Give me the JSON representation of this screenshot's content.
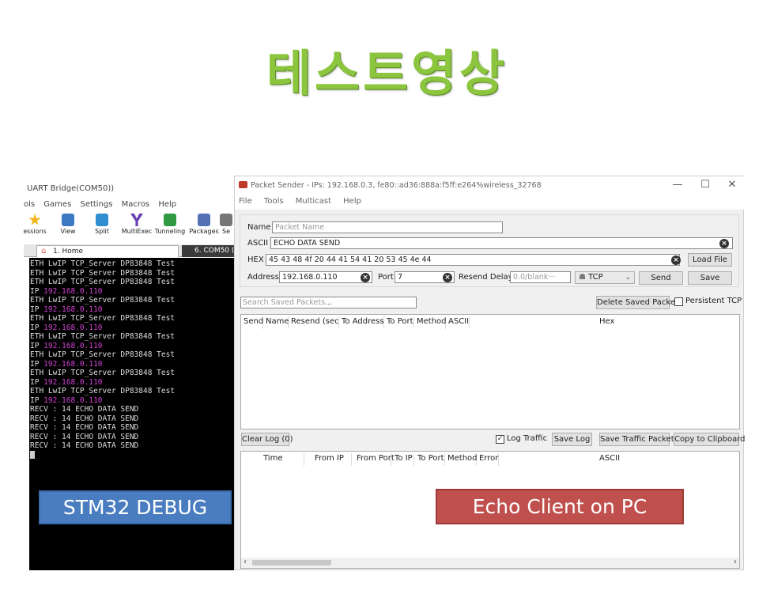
{
  "slide_title": "테스트영상",
  "terminal": {
    "window_title": "UART Bridge(COM50))",
    "menu": [
      "ols",
      "Games",
      "Settings",
      "Macros",
      "Help"
    ],
    "toolbar": [
      {
        "label": "essions",
        "icon": "star-icon",
        "color": "#f2b61c"
      },
      {
        "label": "View",
        "icon": "view-icon",
        "color": "#3c78c3"
      },
      {
        "label": "Split",
        "icon": "split-icon",
        "color": "#2f8fd1"
      },
      {
        "label": "MultiExec",
        "icon": "multiexec-icon",
        "color": "#6a3fb4"
      },
      {
        "label": "Tunneling",
        "icon": "tunneling-icon",
        "color": "#2f9a42"
      },
      {
        "label": "Packages",
        "icon": "packages-icon",
        "color": "#5571b5"
      },
      {
        "label": "Se",
        "icon": "settings-icon",
        "color": "#777777"
      }
    ],
    "tab_home": "1. Home",
    "tab_com": "6. COM50 (",
    "lines": [
      {
        "text": "ETH LwIP TCP_Server DP83848 Test",
        "ip": ""
      },
      {
        "text": "ETH LwIP TCP_Server DP83848 Test",
        "ip": ""
      },
      {
        "text": "ETH LwIP TCP_Server DP83848 Test",
        "ip": ""
      },
      {
        "text": "IP ",
        "ip": "192.168.0.110"
      },
      {
        "text": "ETH LwIP TCP_Server DP83848 Test",
        "ip": ""
      },
      {
        "text": "IP ",
        "ip": "192.168.0.110"
      },
      {
        "text": "ETH LwIP TCP_Server DP83848 Test",
        "ip": ""
      },
      {
        "text": "IP ",
        "ip": "192.168.0.110"
      },
      {
        "text": "ETH LwIP TCP_Server DP83848 Test",
        "ip": ""
      },
      {
        "text": "IP ",
        "ip": "192.168.0.110"
      },
      {
        "text": "ETH LwIP TCP_Server DP83848 Test",
        "ip": ""
      },
      {
        "text": "IP ",
        "ip": "192.168.0.110"
      },
      {
        "text": "ETH LwIP TCP_Server DP83848 Test",
        "ip": ""
      },
      {
        "text": "IP ",
        "ip": "192.168.0.110"
      },
      {
        "text": "ETH LwIP TCP_Server DP83848 Test",
        "ip": ""
      },
      {
        "text": "IP ",
        "ip": "192.168.0.110"
      },
      {
        "text": "RECV : 14 ECHO DATA SEND",
        "ip": ""
      },
      {
        "text": "RECV : 14 ECHO DATA SEND",
        "ip": ""
      },
      {
        "text": "RECV : 14 ECHO DATA SEND",
        "ip": ""
      },
      {
        "text": "RECV : 14 ECHO DATA SEND",
        "ip": ""
      },
      {
        "text": "RECV : 14 ECHO DATA SEND",
        "ip": ""
      }
    ]
  },
  "packet_sender": {
    "title": "Packet Sender - IPs: 192.168.0.3, fe80::ad36:888a:f5ff:e264%wireless_32768",
    "window_controls": {
      "minimize": "—",
      "maximize": "☐",
      "close": "✕"
    },
    "menu": [
      "File",
      "Tools",
      "Multicast",
      "Help"
    ],
    "name_label": "Name",
    "name_placeholder": "Packet Name",
    "ascii_label": "ASCII",
    "ascii_value": "ECHO DATA SEND",
    "hex_label": "HEX",
    "hex_value": "45 43 48 4f 20 44 41 54 41 20 53 45 4e 44",
    "load_file": "Load File",
    "address_label": "Address",
    "address_value": "192.168.0.110",
    "port_label": "Port",
    "port_value": "7",
    "resend_label": "Resend Delay",
    "resend_placeholder": "0.0/blank···",
    "protocol": "TCP",
    "send": "Send",
    "save": "Save",
    "search_placeholder": "Search Saved Packets,,,",
    "delete_saved": "Delete Saved Packet",
    "persistent_tcp": "Persistent TCP",
    "saved_columns": [
      "Send",
      "Name",
      "Resend (sec)",
      "To Address",
      "To Port",
      "Method",
      "ASCII",
      "Hex"
    ],
    "clear_log": "Clear Log (0)",
    "log_traffic": "Log Traffic",
    "save_log": "Save Log",
    "save_traffic_packet": "Save Traffic Packet",
    "copy_clipboard": "Copy to Clipboard",
    "log_columns": [
      "Time",
      "From IP",
      "From Port",
      "To IP",
      "To Port",
      "Method",
      "Error",
      "ASCII"
    ]
  },
  "labels": {
    "left": "STM32 DEBUG",
    "right": "Echo Client on PC"
  }
}
